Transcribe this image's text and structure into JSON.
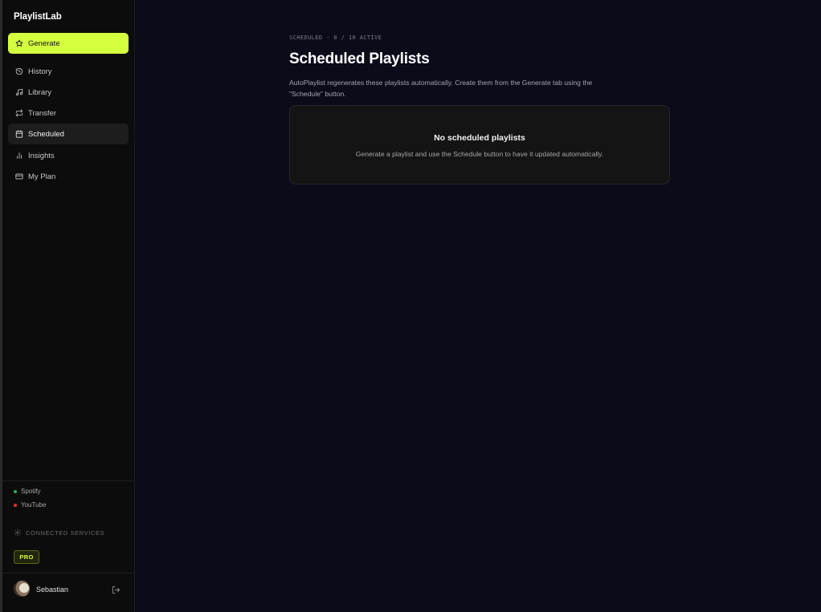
{
  "app": {
    "brand": "PlaylistLab"
  },
  "nav": {
    "items": [
      {
        "label": "Generate",
        "icon": "star-icon",
        "state": "primary"
      },
      {
        "label": "History",
        "icon": "history-icon",
        "state": "normal"
      },
      {
        "label": "Library",
        "icon": "music-note-icon",
        "state": "normal"
      },
      {
        "label": "Transfer",
        "icon": "transfer-arrows-icon",
        "state": "normal"
      },
      {
        "label": "Scheduled",
        "icon": "calendar-icon",
        "state": "active"
      },
      {
        "label": "Insights",
        "icon": "bar-chart-icon",
        "state": "normal"
      },
      {
        "label": "My Plan",
        "icon": "credit-card-icon",
        "state": "normal"
      }
    ]
  },
  "services": [
    {
      "name": "Spotify",
      "status_color": "#1db954"
    },
    {
      "name": "YouTube",
      "status_color": "#ff2b2b"
    }
  ],
  "connected_services_label": "CONNECTED SERVICES",
  "plan_badge": "PRO",
  "user": {
    "name": "Sebastian"
  },
  "page": {
    "eyebrow": "SCHEDULED · 0 / 10 ACTIVE",
    "title": "Scheduled Playlists",
    "description": "AutoPlaylist regenerates these playlists automatically. Create them from the Generate tab using the \"Schedule\" button."
  },
  "empty_state": {
    "title": "No scheduled playlists",
    "description": "Generate a playlist and use the Schedule button to have it updated automatically."
  },
  "colors": {
    "accent": "#d4ff3f",
    "background": "#0b0b1a",
    "sidebar": "#0c0c0c"
  }
}
